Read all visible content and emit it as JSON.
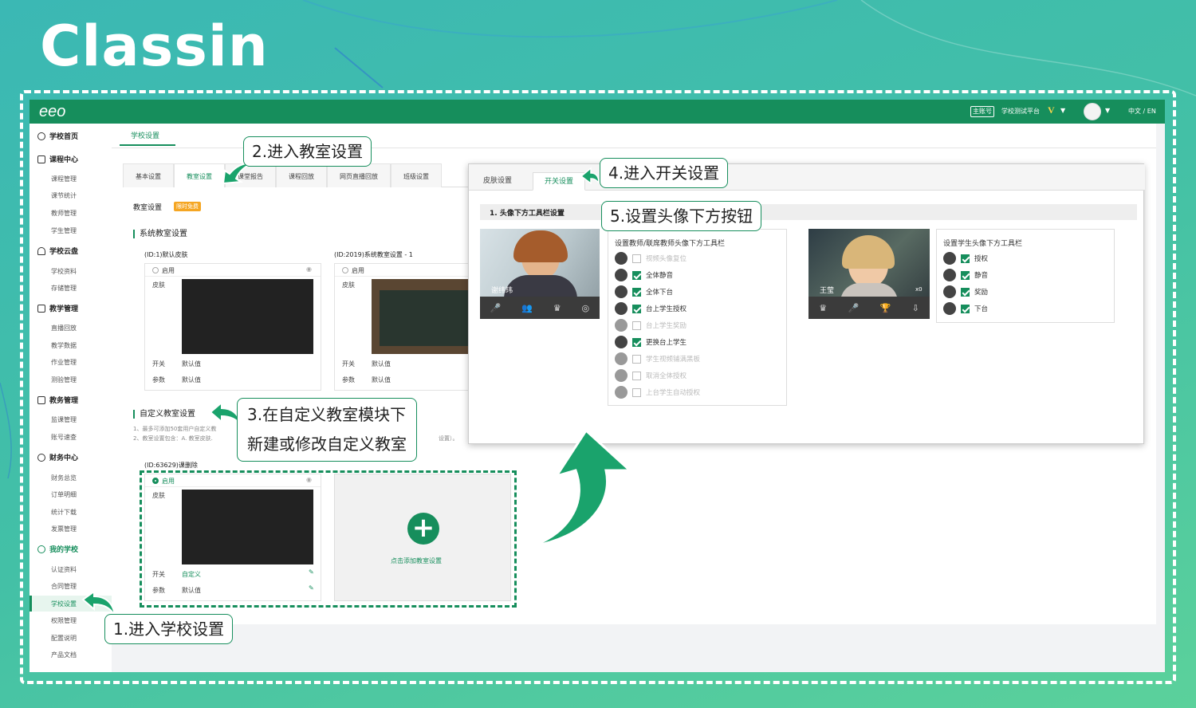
{
  "brand": {
    "logo_text": "Classin",
    "app_logo": "eeo"
  },
  "topbar": {
    "account_badge": "主账号",
    "account_name": "学校测试平台",
    "vip_badge": "V",
    "lang": "中文 / EN"
  },
  "sidebar": {
    "sections": [
      {
        "label": "学校首页",
        "items": []
      },
      {
        "label": "课程中心",
        "items": [
          "课程管理",
          "课节统计",
          "教师管理",
          "学生管理"
        ]
      },
      {
        "label": "学校云盘",
        "items": [
          "学校资料",
          "存储管理"
        ]
      },
      {
        "label": "教学管理",
        "items": [
          "直播回放",
          "教学数据",
          "作业管理",
          "测验管理"
        ]
      },
      {
        "label": "教务管理",
        "items": [
          "监课管理",
          "账号速查"
        ]
      },
      {
        "label": "财务中心",
        "items": [
          "财务总览",
          "订单明细",
          "统计下载",
          "发票管理"
        ]
      },
      {
        "label": "我的学校",
        "items": [
          "认证资料",
          "合同管理",
          "学校设置",
          "权限管理",
          "配置说明",
          "产品文档"
        ]
      }
    ],
    "active_item": "学校设置"
  },
  "main": {
    "page_tab": "学校设置",
    "subtabs": [
      "基本设置",
      "教室设置",
      "课堂报告",
      "课程回放",
      "网页直播回放",
      "班级设置"
    ],
    "active_subtab": "教室设置",
    "classroom_label": "教室设置",
    "limited_tag": "限时免费",
    "system_section": "系统教室设置",
    "cards": [
      {
        "id": "(ID:1)默认皮肤",
        "enable": "启用",
        "skin_label": "皮肤",
        "switch_label": "开关",
        "switch_value": "默认值",
        "param_label": "参数",
        "param_value": "默认值"
      },
      {
        "id": "(ID:2019)系统教室设置 - 1",
        "enable": "启用",
        "skin_label": "皮肤",
        "switch_label": "开关",
        "switch_value": "默认值",
        "param_label": "参数",
        "param_value": "默认值"
      }
    ],
    "custom_section": "自定义教室设置",
    "custom_notes": [
      "1、最多可添加50套用户自定义教",
      "2、教室设置包含：A. 教室皮肤."
    ],
    "custom_note_tail": "设置）。",
    "custom_card": {
      "id": "(ID:63629)课删除",
      "enable": "启用",
      "skin_label": "皮肤",
      "switch_label": "开关",
      "switch_value": "自定义",
      "param_label": "参数",
      "param_value": "默认值"
    },
    "add_label": "点击添加教室设置"
  },
  "overlay": {
    "tabs": [
      "皮肤设置",
      "开关设置"
    ],
    "active_tab": "开关设置",
    "strip_title": "1. 头像下方工具栏设置",
    "teacher_name": "谢纬玮",
    "student_name": "王莹",
    "student_trophy": "x0",
    "teacher_panel": {
      "title": "设置教师/联席教师头像下方工具栏",
      "options": [
        {
          "label": "视频头像复位",
          "checked": false,
          "enabled": false
        },
        {
          "label": "全体静音",
          "checked": true,
          "enabled": true
        },
        {
          "label": "全体下台",
          "checked": true,
          "enabled": true
        },
        {
          "label": "台上学生授权",
          "checked": true,
          "enabled": true
        },
        {
          "label": "台上学生奖励",
          "checked": false,
          "enabled": false
        },
        {
          "label": "更换台上学生",
          "checked": true,
          "enabled": true
        },
        {
          "label": "学生视频铺满黑板",
          "checked": false,
          "enabled": false
        },
        {
          "label": "取消全体授权",
          "checked": false,
          "enabled": false
        },
        {
          "label": "上台学生自动授权",
          "checked": false,
          "enabled": false
        }
      ]
    },
    "student_panel": {
      "title": "设置学生头像下方工具栏",
      "options": [
        {
          "label": "授权",
          "checked": true
        },
        {
          "label": "静音",
          "checked": true
        },
        {
          "label": "奖励",
          "checked": true
        },
        {
          "label": "下台",
          "checked": true
        }
      ]
    }
  },
  "callouts": {
    "step1": "1.进入学校设置",
    "step2": "2.进入教室设置",
    "step3_line1": "3.在自定义教室模块下",
    "step3_line2": "新建或修改自定义教室",
    "step4": "4.进入开关设置",
    "step5": "5.设置头像下方按钮"
  },
  "colors": {
    "brand_green": "#168e5c",
    "accent_green": "#1aa36c",
    "bg_teal": "#43c0a6"
  }
}
